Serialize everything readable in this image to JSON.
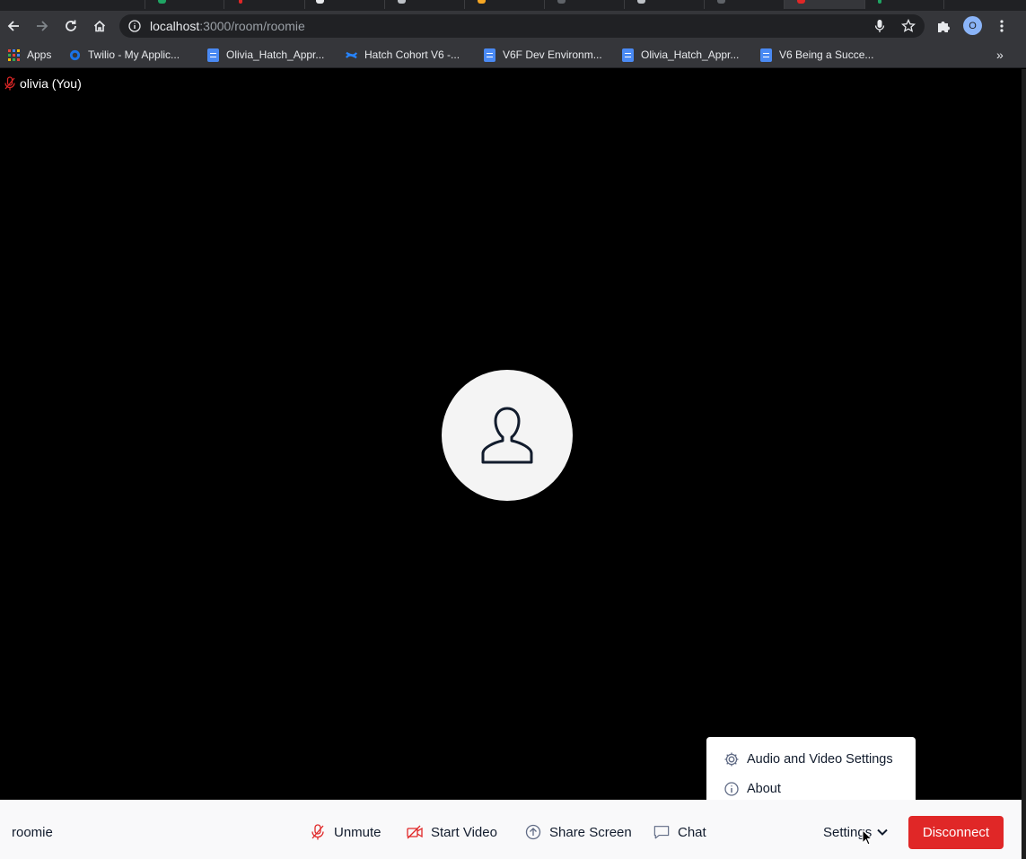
{
  "browser": {
    "url_host": "localhost",
    "url_path": ":3000/room/roomie",
    "profile_initial": "O",
    "bookmarks": [
      {
        "label": "Apps",
        "icon": "apps-grid-icon"
      },
      {
        "label": "Twilio - My Applic...",
        "icon": "twilio-icon"
      },
      {
        "label": "Olivia_Hatch_Appr...",
        "icon": "google-docs-icon"
      },
      {
        "label": "Hatch Cohort V6 -...",
        "icon": "confluence-icon"
      },
      {
        "label": "V6F Dev Environm...",
        "icon": "google-docs-icon"
      },
      {
        "label": "Olivia_Hatch_Appr...",
        "icon": "google-docs-icon"
      },
      {
        "label": "V6 Being a Succe...",
        "icon": "google-docs-icon"
      }
    ],
    "overflow": "»"
  },
  "participant": {
    "label": "olivia (You)",
    "mic_state": "muted"
  },
  "settings_menu": {
    "items": [
      {
        "label": "Audio and Video Settings",
        "icon": "gear-icon"
      },
      {
        "label": "About",
        "icon": "info-icon"
      }
    ]
  },
  "controls": {
    "room_name": "roomie",
    "unmute": "Unmute",
    "start_video": "Start Video",
    "share_screen": "Share Screen",
    "chat": "Chat",
    "settings": "Settings",
    "disconnect": "Disconnect"
  },
  "colors": {
    "disconnect": "#e02727",
    "muted_icon": "#e02727",
    "bottom_bar": "#f9f9fa"
  }
}
